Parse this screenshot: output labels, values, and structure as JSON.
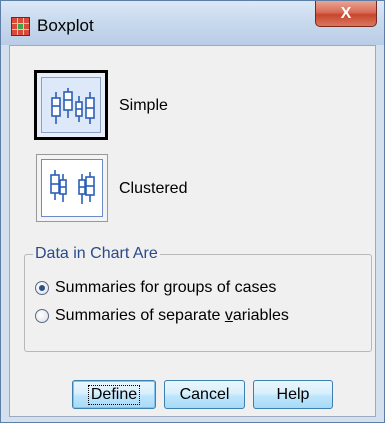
{
  "window": {
    "title": "Boxplot",
    "close_label": "X"
  },
  "chart_types": [
    {
      "label": "Simple",
      "icon": "simple-boxplot-icon",
      "selected": true
    },
    {
      "label": "Clustered",
      "icon": "clustered-boxplot-icon",
      "selected": false
    }
  ],
  "data_group": {
    "legend": "Data in Chart Are",
    "options": [
      {
        "pre": "Summaries for ",
        "accel": "g",
        "post": "roups of cases",
        "checked": true
      },
      {
        "pre": "Summaries of separate ",
        "accel": "v",
        "post": "ariables",
        "checked": false
      }
    ]
  },
  "buttons": {
    "define": "Define",
    "cancel": "Cancel",
    "help": "Help"
  },
  "colors": {
    "title_icon": "#d32f2f",
    "close_button": "#c7462d",
    "button_border": "#3c7fb1",
    "boxplot_icon": "#2d5fb8"
  }
}
